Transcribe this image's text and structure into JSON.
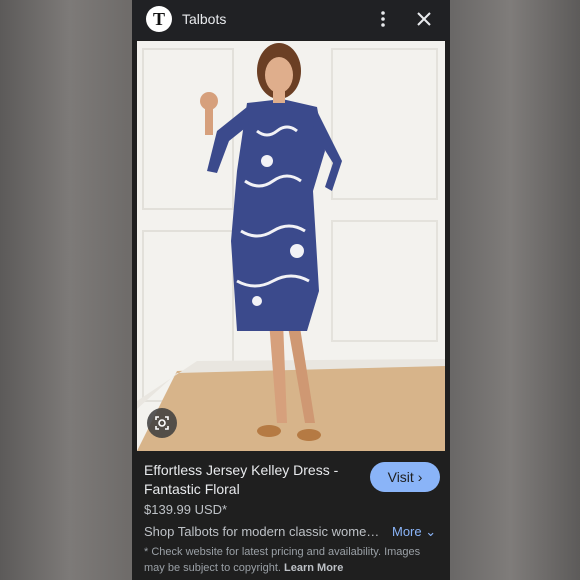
{
  "header": {
    "logo_letter": "T",
    "source": "Talbots",
    "more_icon": "more-vert-icon",
    "close_icon": "close-icon"
  },
  "image": {
    "lens_icon": "lens-search-icon"
  },
  "product": {
    "title_line1": "Effortless Jersey Kelley Dress -",
    "title_line2": "Fantastic Floral",
    "visit_label": "Visit",
    "price": "$139.99 USD*",
    "description": "Shop Talbots for modern classic wome…",
    "more_label": "More",
    "disclaimer": "* Check website for latest pricing and availability. Images may be subject to copyright.",
    "learn_more": "Learn More"
  },
  "colors": {
    "accent": "#8ab4f8",
    "background": "#202124"
  }
}
